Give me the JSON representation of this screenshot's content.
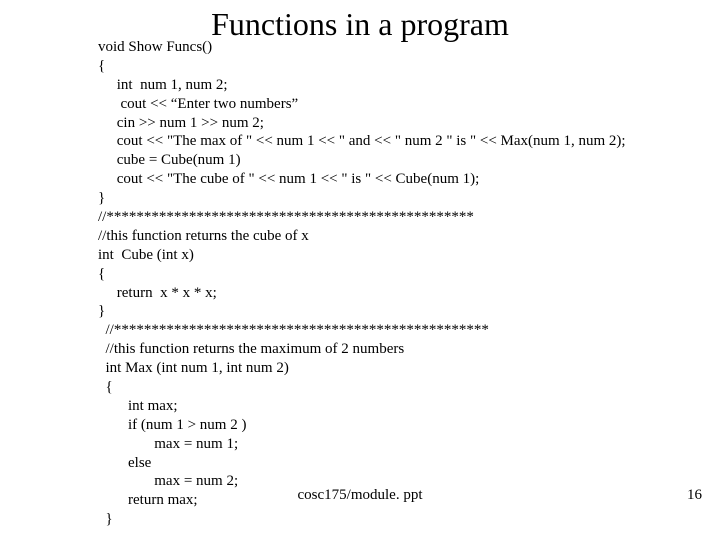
{
  "title": "Functions in a program",
  "code": {
    "l01": "void Show Funcs()",
    "l02": "{",
    "l03": "     int  num 1, num 2;",
    "l04": "      cout << “Enter two numbers”",
    "l05": "     cin >> num 1 >> num 2;",
    "l06": "     cout << \"The max of \" << num 1 << \" and << \" num 2 \" is \" << Max(num 1, num 2);",
    "l07": "     cube = Cube(num 1)",
    "l08": "     cout << \"The cube of \" << num 1 << \" is \" << Cube(num 1);",
    "l09": "}",
    "l10": "//*************************************************",
    "l11": "//this function returns the cube of x",
    "l12": "int  Cube (int x)",
    "l13": "{",
    "l14": "     return  x * x * x;",
    "l15": "}",
    "l16": "//**************************************************",
    "l17": "//this function returns the maximum of 2 numbers",
    "l18": "int Max (int num 1, int num 2)",
    "l19": "{",
    "l20": "        int max;",
    "l21": "        if (num 1 > num 2 )",
    "l22": "               max = num 1;",
    "l23": "        else",
    "l24": "               max = num 2;",
    "l25": "        return max;",
    "l26": "}"
  },
  "footer": {
    "path": "cosc175/module. ppt",
    "page": "16"
  }
}
